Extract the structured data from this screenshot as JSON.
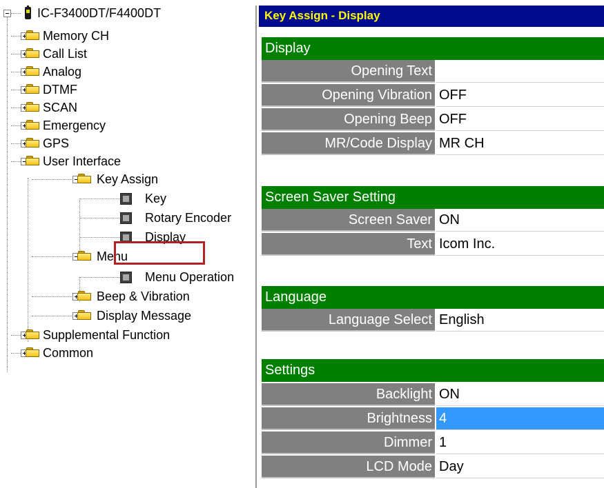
{
  "tree": {
    "root": "IC-F3400DT/F4400DT",
    "items": [
      {
        "label": "Memory CH"
      },
      {
        "label": "Call List"
      },
      {
        "label": "Analog"
      },
      {
        "label": "DTMF"
      },
      {
        "label": "SCAN"
      },
      {
        "label": "Emergency"
      },
      {
        "label": "GPS"
      },
      {
        "label": "User Interface"
      },
      {
        "label": "Key Assign"
      },
      {
        "label": "Key"
      },
      {
        "label": "Rotary Encoder"
      },
      {
        "label": "Display"
      },
      {
        "label": "Menu"
      },
      {
        "label": "Menu Operation"
      },
      {
        "label": "Beep & Vibration"
      },
      {
        "label": "Display Message"
      },
      {
        "label": "Supplemental Function"
      },
      {
        "label": "Common"
      }
    ]
  },
  "panel": {
    "title": "Key Assign - Display",
    "sections": [
      {
        "header": "Display",
        "rows": [
          {
            "label": "Opening Text",
            "value": ""
          },
          {
            "label": "Opening Vibration",
            "value": "OFF"
          },
          {
            "label": "Opening Beep",
            "value": "OFF"
          },
          {
            "label": "MR/Code Display",
            "value": "MR CH"
          }
        ]
      },
      {
        "header": "Screen Saver Setting",
        "rows": [
          {
            "label": "Screen Saver",
            "value": "ON"
          },
          {
            "label": "Text",
            "value": "Icom Inc."
          }
        ]
      },
      {
        "header": "Language",
        "rows": [
          {
            "label": "Language Select",
            "value": "English"
          }
        ]
      },
      {
        "header": "Settings",
        "rows": [
          {
            "label": "Backlight",
            "value": "ON"
          },
          {
            "label": "Brightness",
            "value": "4"
          },
          {
            "label": "Dimmer",
            "value": "1"
          },
          {
            "label": "LCD Mode",
            "value": "Day"
          }
        ]
      }
    ]
  },
  "colors": {
    "title_bg": "#000a8c",
    "title_text": "#ffff00",
    "section_bg": "#008000",
    "label_bg": "#808080",
    "selected_bg": "#3399ff",
    "highlight": "#b22222"
  }
}
